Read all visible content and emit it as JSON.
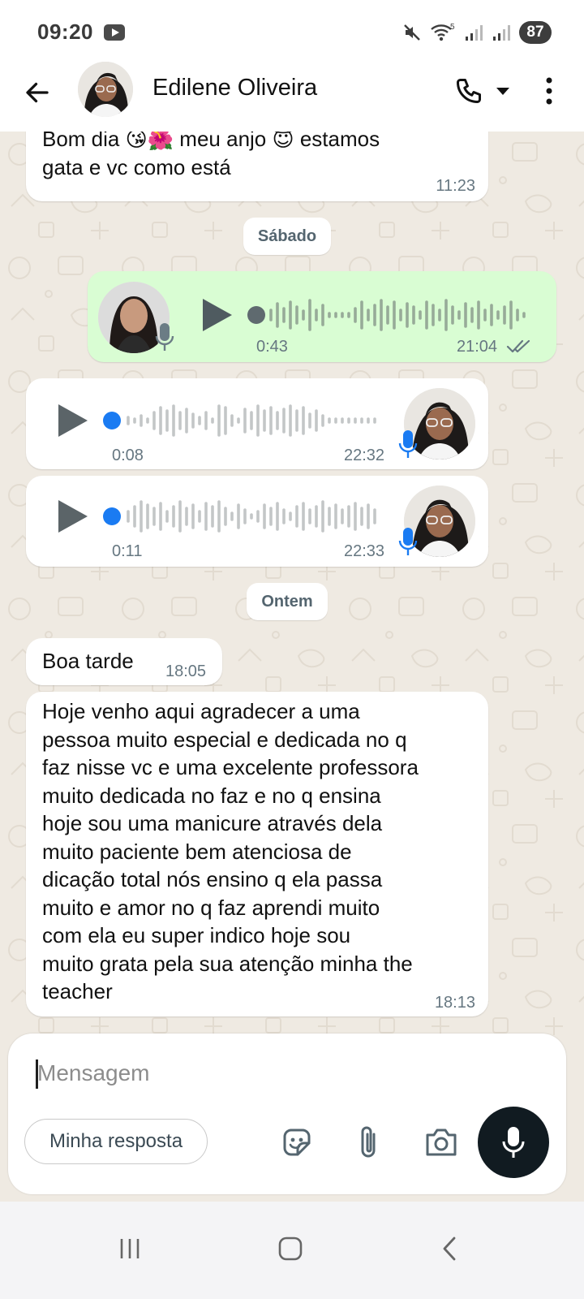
{
  "status_bar": {
    "time": "09:20",
    "battery": "87",
    "icons": [
      "youtube-icon",
      "mute-icon",
      "wifi-icon",
      "signal-icon",
      "signal-icon",
      "battery-icon"
    ]
  },
  "header": {
    "contact_name": "Edilene Oliveira",
    "icons": [
      "back-arrow-icon",
      "avatar",
      "phone-icon",
      "dropdown-icon",
      "more-vert-icon"
    ]
  },
  "messages": [
    {
      "direction": "incoming",
      "text": "Bom dia 😘🌺 meu anjo 😇  estamos\ngata e vc como está",
      "time": "11:23"
    },
    {
      "type": "date",
      "label": "Sábado"
    },
    {
      "direction": "outgoing",
      "type": "audio",
      "duration": "0:43",
      "time": "21:04",
      "status": "read"
    },
    {
      "direction": "incoming",
      "type": "audio",
      "duration": "0:08",
      "time": "22:32"
    },
    {
      "direction": "incoming",
      "type": "audio",
      "duration": "0:11",
      "time": "22:33"
    },
    {
      "type": "date",
      "label": "Ontem"
    },
    {
      "direction": "incoming",
      "text": "Boa tarde",
      "time": "18:05"
    },
    {
      "direction": "incoming",
      "text": "Hoje venho aqui agradecer a uma\npessoa muito especial e dedicada no q\nfaz nisse vc e uma excelente professora\nmuito dedicada no faz e no q ensina\nhoje sou uma manicure através dela\nmuito paciente bem atenciosa de\ndicação  total nós ensino q ela passa\nmuito e amor no q faz  aprendi muito\ncom ela  eu super indico hoje sou\nmuito grata pela sua atenção minha the\nteacher",
      "time": "18:13"
    }
  ],
  "composer": {
    "placeholder": "Mensagem",
    "quick_reply": "Minha resposta",
    "icons": [
      "sticker-icon",
      "attach-icon",
      "camera-icon",
      "mic-icon"
    ]
  },
  "colors": {
    "chat_background": "#efeae2",
    "incoming_bubble": "#ffffff",
    "outgoing_bubble": "#d9fdd3",
    "read_ticks": "#667781",
    "audio_dot_incoming": "#1a7bf2",
    "mic_button": "#111b21"
  }
}
